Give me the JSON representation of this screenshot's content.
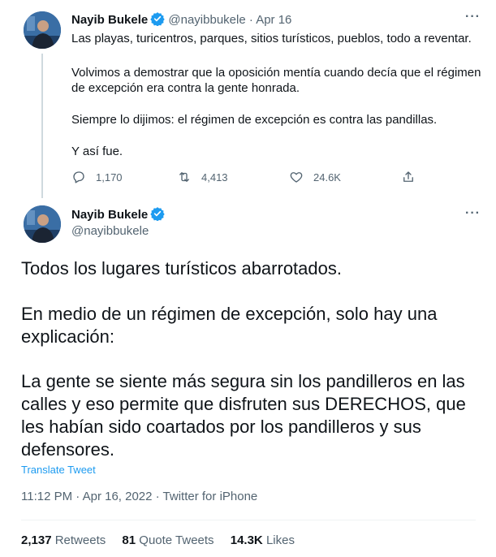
{
  "tweet1": {
    "name": "Nayib Bukele",
    "handle": "@nayibbukele",
    "date": "Apr 16",
    "lines": [
      "Las playas, turicentros, parques, sitios turísticos, pueblos, todo a reventar.",
      "Volvimos a demostrar que la oposición mentía cuando decía que el régimen",
      "de excepción era contra la gente honrada.",
      "Siempre lo dijimos: el régimen de excepción es contra las pandillas.",
      "Y así fue."
    ],
    "replies": "1,170",
    "retweets": "4,413",
    "likes": "24.6K"
  },
  "tweet2": {
    "name": "Nayib Bukele",
    "handle": "@nayibbukele",
    "lines": [
      "Todos los lugares turísticos abarrotados.",
      "En medio de un régimen de excepción, solo hay una",
      "explicación:",
      "La gente se siente más segura sin los pandilleros en las",
      "calles y eso permite que disfruten sus DERECHOS, que",
      "les habían sido coartados por los pandilleros y sus",
      "defensores."
    ],
    "translate": "Translate Tweet",
    "meta": "11:12 PM · Apr 16, 2022 · Twitter for iPhone",
    "retweets_count": "2,137",
    "retweets_label": "Retweets",
    "quotes_count": "81",
    "quotes_label": "Quote Tweets",
    "likes_count": "14.3K",
    "likes_label": "Likes"
  },
  "colors": {
    "accent": "#1d9bf0",
    "text": "#0f1419",
    "secondary": "#536471"
  },
  "icons": [
    "verified-badge-icon",
    "more-icon",
    "reply-icon",
    "retweet-icon",
    "like-icon",
    "share-icon"
  ]
}
